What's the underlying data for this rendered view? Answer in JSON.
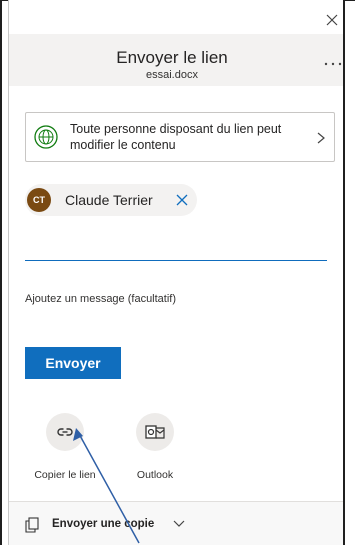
{
  "header": {
    "title": "Envoyer le lien",
    "file_name": "essai.docx",
    "more_label": "..."
  },
  "link_settings": {
    "text": "Toute personne disposant du lien peut modifier le contenu",
    "icon": "globe-icon"
  },
  "recipients": [
    {
      "initials": "CT",
      "name": "Claude Terrier",
      "avatar_color": "#7a4a12"
    }
  ],
  "message": {
    "placeholder": "Ajoutez un message (facultatif)"
  },
  "send_button": {
    "label": "Envoyer",
    "color": "#106ebe"
  },
  "share_options": [
    {
      "label": "Copier le lien",
      "icon": "link-icon"
    },
    {
      "label": "Outlook",
      "icon": "outlook-icon"
    }
  ],
  "footer": {
    "send_copy_label": "Envoyer une copie"
  },
  "colors": {
    "accent": "#106ebe",
    "header_bg": "#f3f2f1",
    "annotation_arrow": "#2f5fa6"
  }
}
